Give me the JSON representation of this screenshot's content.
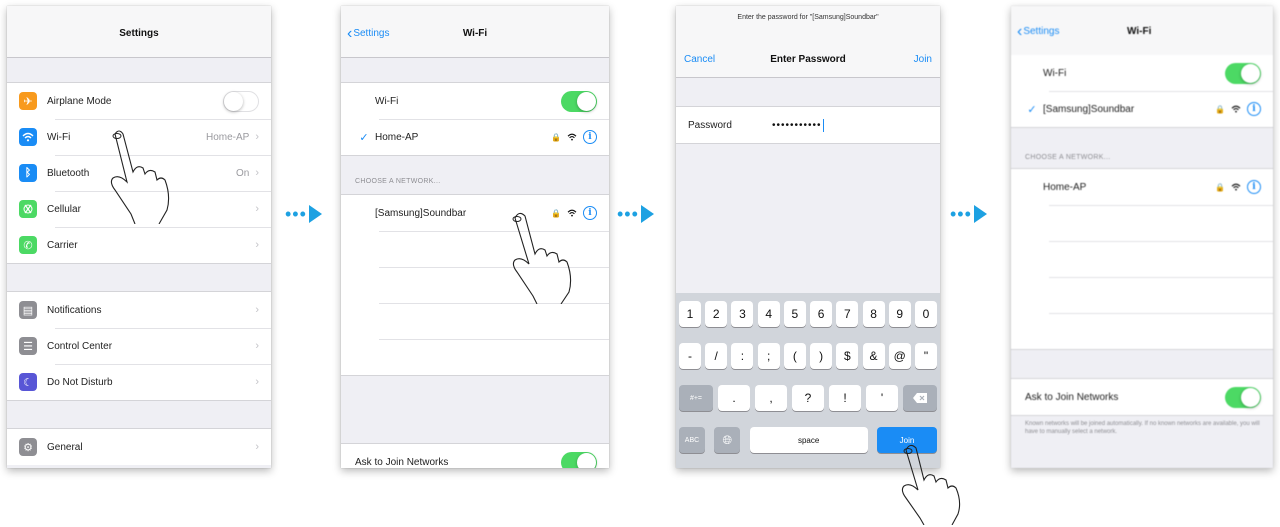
{
  "panel1": {
    "title": "Settings",
    "group1": [
      {
        "icon": "airplane-icon",
        "color": "#f89a1d",
        "label": "Airplane Mode",
        "toggle": "off"
      },
      {
        "icon": "wifi-icon",
        "color": "#1a8cf5",
        "label": "Wi-Fi",
        "detail": "Home-AP"
      },
      {
        "icon": "bluetooth-icon",
        "color": "#1a8cf5",
        "label": "Bluetooth",
        "detail": "On"
      },
      {
        "icon": "cellular-icon",
        "color": "#4cd964",
        "label": "Cellular"
      },
      {
        "icon": "phone-icon",
        "color": "#4cd964",
        "label": "Carrier"
      }
    ],
    "group2": [
      {
        "icon": "notifications-icon",
        "color": "#8e8e93",
        "label": "Notifications"
      },
      {
        "icon": "control-center-icon",
        "color": "#8e8e93",
        "label": "Control Center"
      },
      {
        "icon": "moon-icon",
        "color": "#5856d6",
        "label": "Do Not Disturb"
      }
    ],
    "group3": [
      {
        "icon": "gear-icon",
        "color": "#8e8e93",
        "label": "General"
      }
    ]
  },
  "panel2": {
    "back": "Settings",
    "title": "Wi-Fi",
    "wifi_label": "Wi-Fi",
    "connected": "Home-AP",
    "section": "CHOOSE A NETWORK...",
    "network": "[Samsung]Soundbar",
    "ask_label": "Ask to Join Networks"
  },
  "panel3": {
    "prompt": "Enter the password for \"[Samsung]Soundbar\"",
    "cancel": "Cancel",
    "title": "Enter Password",
    "join": "Join",
    "password_label": "Password",
    "password_value": "•••••••••••",
    "keyboard": {
      "row1": [
        "1",
        "2",
        "3",
        "4",
        "5",
        "6",
        "7",
        "8",
        "9",
        "0"
      ],
      "row2": [
        "-",
        "/",
        ":",
        ";",
        "(",
        ")",
        "$",
        "&",
        "@",
        "\""
      ],
      "row3_left": "#+=",
      "row3": [
        ".",
        ",",
        "?",
        "!",
        "'"
      ],
      "abc": "ABC",
      "space": "space",
      "join_key": "Join"
    }
  },
  "panel4": {
    "back": "Settings",
    "title": "Wi-Fi",
    "wifi_label": "Wi-Fi",
    "connected": "[Samsung]Soundbar",
    "section": "CHOOSE A NETWORK...",
    "network": "Home-AP",
    "ask_label": "Ask to Join Networks",
    "ask_note": "Known networks will be joined automatically. If no known networks are available, you will have to manually select a network."
  },
  "colors": {
    "accent": "#1a8cf5",
    "toggle_on": "#4cd964",
    "arrow": "#1da1e2"
  }
}
